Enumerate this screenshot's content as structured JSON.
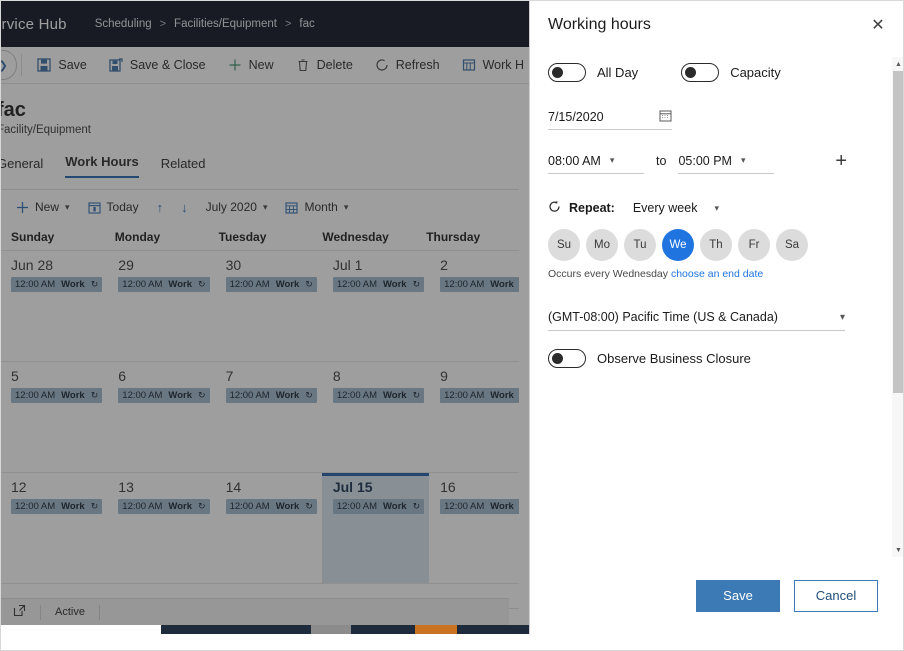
{
  "nav": {
    "brand": "ervice Hub",
    "breadcrumbs": [
      "Scheduling",
      "Facilities/Equipment",
      "fac"
    ],
    "separator": ">"
  },
  "command_bar": {
    "expand_icon": "chevron-right-circle-icon",
    "buttons": [
      {
        "label": "Save",
        "icon": "save-icon"
      },
      {
        "label": "Save & Close",
        "icon": "save-close-icon"
      },
      {
        "label": "New",
        "icon": "plus-icon"
      },
      {
        "label": "Delete",
        "icon": "trash-icon"
      },
      {
        "label": "Refresh",
        "icon": "refresh-icon"
      },
      {
        "label": "Work H",
        "icon": "work-hours-icon"
      }
    ]
  },
  "record": {
    "title": "fac",
    "subtitle": "Facility/Equipment",
    "tabs": [
      {
        "label": "General",
        "selected": false
      },
      {
        "label": "Work Hours",
        "selected": true
      },
      {
        "label": "Related",
        "selected": false
      }
    ]
  },
  "calendar": {
    "toolbar": {
      "new_label": "New",
      "today_label": "Today",
      "up_arrow": "↑",
      "down_arrow": "↓",
      "period_label": "July 2020",
      "view_label": "Month"
    },
    "day_headers": [
      "Sunday",
      "Monday",
      "Tuesday",
      "Wednesday",
      "Thursday"
    ],
    "event_time": "12:00 AM",
    "event_name": "Work",
    "event_recurring_icon": "recurrence-icon",
    "weeks": [
      [
        {
          "num": "Jun 28",
          "today": false,
          "event": true
        },
        {
          "num": "29",
          "today": false,
          "event": true
        },
        {
          "num": "30",
          "today": false,
          "event": true
        },
        {
          "num": "Jul 1",
          "today": false,
          "event": true
        },
        {
          "num": "2",
          "today": false,
          "event": true
        }
      ],
      [
        {
          "num": "5",
          "today": false,
          "event": true
        },
        {
          "num": "6",
          "today": false,
          "event": true
        },
        {
          "num": "7",
          "today": false,
          "event": true
        },
        {
          "num": "8",
          "today": false,
          "event": true
        },
        {
          "num": "9",
          "today": false,
          "event": true
        }
      ],
      [
        {
          "num": "12",
          "today": false,
          "event": true
        },
        {
          "num": "13",
          "today": false,
          "event": true
        },
        {
          "num": "14",
          "today": false,
          "event": true
        },
        {
          "num": "Jul 15",
          "today": true,
          "event": true
        },
        {
          "num": "16",
          "today": false,
          "event": true
        }
      ]
    ]
  },
  "status_bar": {
    "popout_icon": "open-in-new-icon",
    "state": "Active"
  },
  "panel": {
    "title": "Working hours",
    "close_icon": "close-icon",
    "all_day": {
      "label": "All Day",
      "on": false
    },
    "capacity": {
      "label": "Capacity",
      "on": false
    },
    "date": {
      "value": "7/15/2020",
      "icon": "calendar-icon"
    },
    "start_time": "08:00 AM",
    "to_label": "to",
    "end_time": "05:00 PM",
    "add_icon": "plus-icon",
    "repeat": {
      "icon": "recurrence-icon",
      "label": "Repeat:",
      "value": "Every week"
    },
    "days": [
      {
        "label": "Su",
        "selected": false
      },
      {
        "label": "Mo",
        "selected": false
      },
      {
        "label": "Tu",
        "selected": false
      },
      {
        "label": "We",
        "selected": true
      },
      {
        "label": "Th",
        "selected": false
      },
      {
        "label": "Fr",
        "selected": false
      },
      {
        "label": "Sa",
        "selected": false
      }
    ],
    "occurs_text": "Occurs every Wednesday",
    "end_date_link": "choose an end date",
    "timezone": "(GMT-08:00) Pacific Time (US & Canada)",
    "observe_closure": {
      "label": "Observe Business Closure",
      "on": false
    },
    "save_label": "Save",
    "cancel_label": "Cancel",
    "scroll_up_icon": "▲",
    "scroll_down_icon": "▼"
  },
  "colors": {
    "navbar": "#0b1222",
    "accent_blue": "#1f74e0",
    "primary_button": "#3b7ab5",
    "today_highlight": "#d7e3ef",
    "event_chip": "#9fb8cd",
    "taskbar_navy": "#1d2b3c",
    "taskbar_orange": "#c9721f"
  }
}
